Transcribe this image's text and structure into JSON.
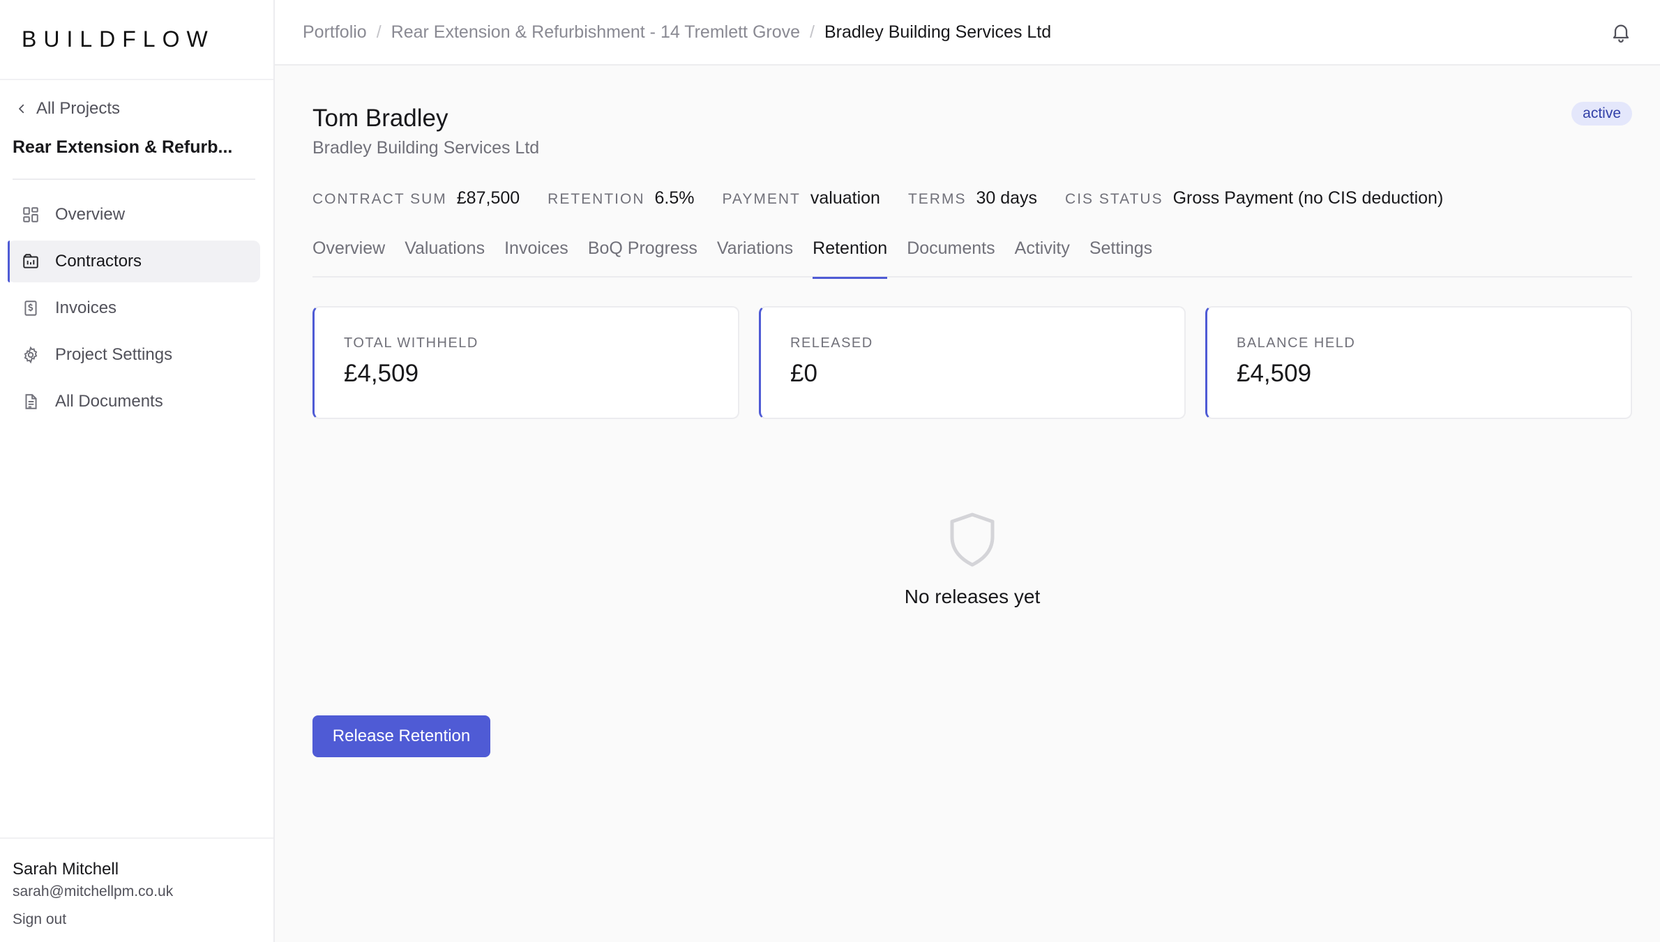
{
  "app": {
    "logo": "BUILDFLOW"
  },
  "sidebar": {
    "back_label": "All Projects",
    "project_name": "Rear Extension & Refurb...",
    "items": [
      {
        "label": "Overview",
        "icon": "grid-icon",
        "active": false
      },
      {
        "label": "Contractors",
        "icon": "contractors-icon",
        "active": true
      },
      {
        "label": "Invoices",
        "icon": "invoice-icon",
        "active": false
      },
      {
        "label": "Project Settings",
        "icon": "gear-icon",
        "active": false
      },
      {
        "label": "All Documents",
        "icon": "document-icon",
        "active": false
      }
    ],
    "user": {
      "name": "Sarah Mitchell",
      "email": "sarah@mitchellpm.co.uk",
      "sign_out": "Sign out"
    }
  },
  "breadcrumb": [
    "Portfolio",
    "Rear Extension & Refurbishment - 14 Tremlett Grove",
    "Bradley Building Services Ltd"
  ],
  "header": {
    "title": "Tom Bradley",
    "subtitle": "Bradley Building Services Ltd",
    "status": "active"
  },
  "meta": [
    {
      "label": "CONTRACT SUM",
      "value": "£87,500"
    },
    {
      "label": "RETENTION",
      "value": "6.5%"
    },
    {
      "label": "PAYMENT",
      "value": "valuation"
    },
    {
      "label": "TERMS",
      "value": "30 days"
    },
    {
      "label": "CIS STATUS",
      "value": "Gross Payment (no CIS deduction)"
    }
  ],
  "tabs": [
    {
      "label": "Overview"
    },
    {
      "label": "Valuations"
    },
    {
      "label": "Invoices"
    },
    {
      "label": "BoQ Progress"
    },
    {
      "label": "Variations"
    },
    {
      "label": "Retention",
      "active": true
    },
    {
      "label": "Documents"
    },
    {
      "label": "Activity"
    },
    {
      "label": "Settings"
    }
  ],
  "cards": [
    {
      "label": "TOTAL WITHHELD",
      "value": "£4,509"
    },
    {
      "label": "RELEASED",
      "value": "£0"
    },
    {
      "label": "BALANCE HELD",
      "value": "£4,509"
    }
  ],
  "empty_state": {
    "icon": "shield-icon",
    "text": "No releases yet"
  },
  "actions": {
    "release_label": "Release Retention"
  },
  "colors": {
    "accent": "#4f5bd5",
    "badge_bg": "#e4e7fb",
    "badge_text": "#3341a8"
  }
}
